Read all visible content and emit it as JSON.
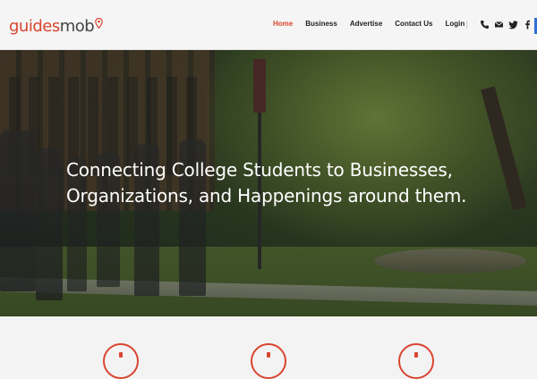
{
  "header": {
    "logo": {
      "part1": "guides",
      "part2": "mob"
    },
    "nav": [
      {
        "label": "Home",
        "active": true
      },
      {
        "label": "Business",
        "active": false
      },
      {
        "label": "Advertise",
        "active": false
      },
      {
        "label": "Contact Us",
        "active": false
      },
      {
        "label": "Login",
        "active": false
      }
    ],
    "social_icons": [
      "phone-icon",
      "mail-icon",
      "twitter-icon",
      "facebook-icon"
    ]
  },
  "hero": {
    "headline_line1": "Connecting College Students to Businesses,",
    "headline_line2": "Organizations, and Happenings around them."
  },
  "colors": {
    "accent": "#d9452f",
    "nav_text": "#222222",
    "header_bg": "#f5f5f5",
    "edge_blue": "#2f6fd3"
  }
}
